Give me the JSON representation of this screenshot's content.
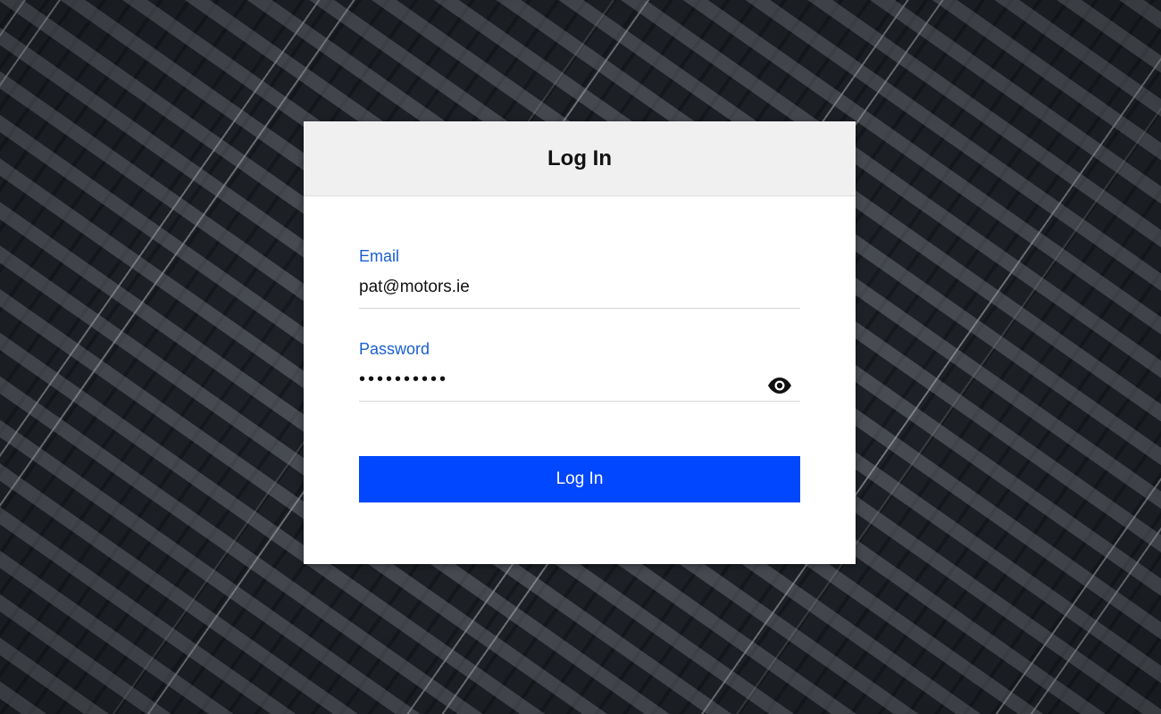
{
  "header": {
    "title": "Log In"
  },
  "form": {
    "email": {
      "label": "Email",
      "value": "pat@motors.ie"
    },
    "password": {
      "label": "Password",
      "masked_value": "••••••••••",
      "toggle_icon": "eye-icon"
    },
    "submit_label": "Log In"
  },
  "colors": {
    "accent": "#0047ff",
    "label": "#1a5fd0",
    "header_bg": "#f0f0f0"
  }
}
